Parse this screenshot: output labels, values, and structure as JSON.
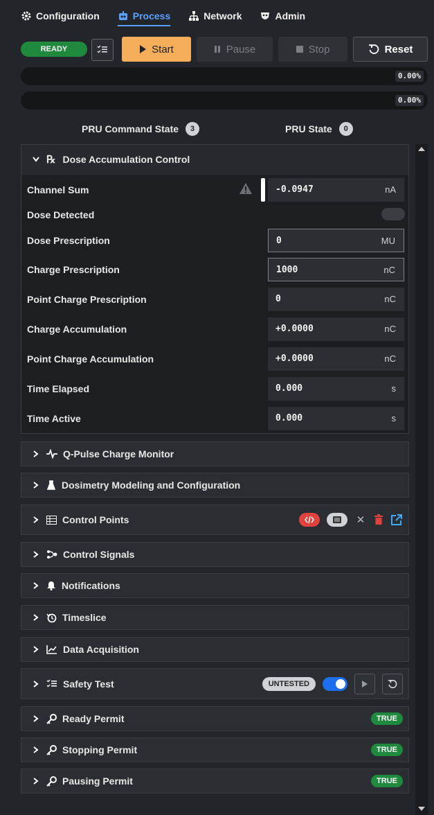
{
  "nav": {
    "tabs": [
      {
        "label": "Configuration",
        "icon": "gear-icon"
      },
      {
        "label": "Process",
        "icon": "robot-icon",
        "active": true
      },
      {
        "label": "Network",
        "icon": "sitemap-icon"
      },
      {
        "label": "Admin",
        "icon": "mask-icon"
      }
    ]
  },
  "toolbar": {
    "status": "READY",
    "start_label": "Start",
    "pause_label": "Pause",
    "stop_label": "Stop",
    "reset_label": "Reset"
  },
  "progress": [
    {
      "label": "0.00%",
      "fraction": 0.0
    },
    {
      "label": "0.00%",
      "fraction": 0.0
    }
  ],
  "state": {
    "pru_command_label": "PRU Command State",
    "pru_command_count": "3",
    "pru_state_label": "PRU State",
    "pru_state_count": "0"
  },
  "dose_panel": {
    "title": "Dose Accumulation Control",
    "rows": [
      {
        "label": "Channel Sum",
        "value": "-0.0947",
        "unit": "nA"
      },
      {
        "label": "Dose Detected"
      },
      {
        "label": "Dose Prescription",
        "value": "0",
        "unit": "MU"
      },
      {
        "label": "Charge Prescription",
        "value": "1000",
        "unit": "nC"
      },
      {
        "label": "Point Charge Prescription",
        "value": "0",
        "unit": "nC"
      },
      {
        "label": "Charge Accumulation",
        "value": "+0.0000",
        "unit": "nC"
      },
      {
        "label": "Point Charge Accumulation",
        "value": "+0.0000",
        "unit": "nC"
      },
      {
        "label": "Time Elapsed",
        "value": "0.000",
        "unit": "s"
      },
      {
        "label": "Time Active",
        "value": "0.000",
        "unit": "s"
      }
    ]
  },
  "panels": [
    {
      "title": "Q-Pulse Charge Monitor",
      "icon": "pulse-icon"
    },
    {
      "title": "Dosimetry Modeling and Configuration",
      "icon": "flask-icon"
    },
    {
      "title": "Control Points",
      "icon": "table-icon"
    },
    {
      "title": "Control Signals",
      "icon": "signal-icon"
    },
    {
      "title": "Notifications",
      "icon": "bell-icon"
    },
    {
      "title": "Timeslice",
      "icon": "history-icon"
    },
    {
      "title": "Data Acquisition",
      "icon": "chart-icon"
    },
    {
      "title": "Safety Test",
      "icon": "checklist-icon",
      "badge": "UNTESTED"
    },
    {
      "title": "Ready Permit",
      "icon": "key-icon",
      "badge": "TRUE"
    },
    {
      "title": "Stopping Permit",
      "icon": "key-icon",
      "badge": "TRUE"
    },
    {
      "title": "Pausing Permit",
      "icon": "key-icon",
      "badge": "TRUE"
    }
  ],
  "colors": {
    "accent": "#5aa0ff",
    "start": "#f6ae5b",
    "ready": "#1f8a3e",
    "danger": "#e0433d",
    "link": "#3fa9f5"
  }
}
